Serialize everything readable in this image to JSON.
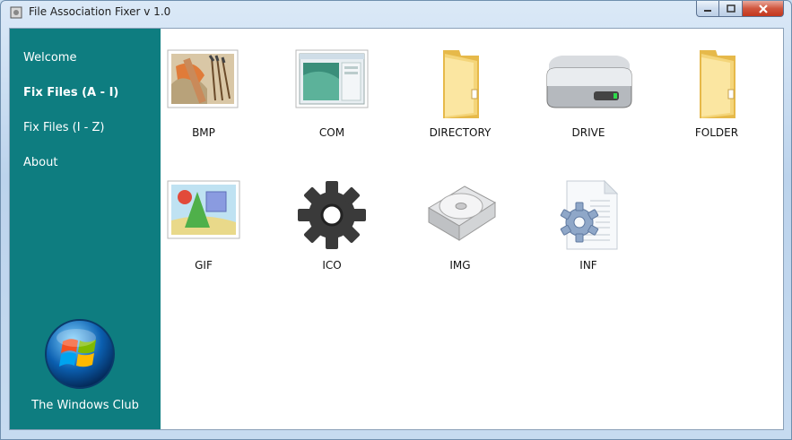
{
  "window": {
    "title": "File Association Fixer v 1.0"
  },
  "sidebar": {
    "items": [
      {
        "label": "Welcome",
        "active": false
      },
      {
        "label": "Fix Files (A - I)",
        "active": true
      },
      {
        "label": "Fix Files (I - Z)",
        "active": false
      },
      {
        "label": "About",
        "active": false
      }
    ],
    "brand": "The Windows Club"
  },
  "files": [
    {
      "label": "BMP",
      "icon": "bmp-paint-icon"
    },
    {
      "label": "COM",
      "icon": "com-window-icon"
    },
    {
      "label": "DIRECTORY",
      "icon": "folder-icon"
    },
    {
      "label": "DRIVE",
      "icon": "drive-icon"
    },
    {
      "label": "FOLDER",
      "icon": "folder-icon"
    },
    {
      "label": "GIF",
      "icon": "gif-image-icon"
    },
    {
      "label": "ICO",
      "icon": "gear-icon"
    },
    {
      "label": "IMG",
      "icon": "disc-case-icon"
    },
    {
      "label": "INF",
      "icon": "inf-settings-icon"
    }
  ],
  "colors": {
    "sidebar": "#0e7d80",
    "close_button": "#c8412a"
  }
}
